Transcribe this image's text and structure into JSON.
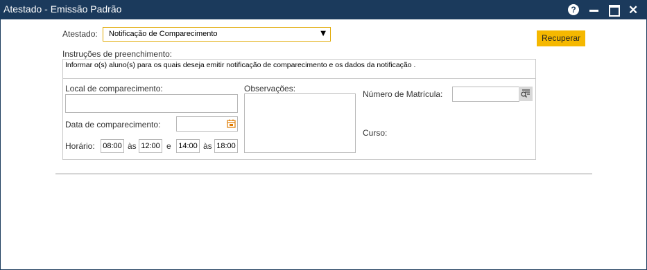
{
  "window": {
    "title": "Atestado - Emissão Padrão",
    "help_icon": "question-circle-icon",
    "help_glyph": "?",
    "close_glyph": "✕"
  },
  "form": {
    "atestado_label": "Atestado:",
    "atestado_value": "Notificação de Comparecimento",
    "recover_label": "Recuperar",
    "instructions_label": "Instruções de preenchimento:",
    "instructions_text": "Informar o(s) aluno(s) para os quais deseja emitir notificação de comparecimento e os dados da notificação .",
    "local_label": "Local de comparecimento:",
    "local_value": "",
    "data_label": "Data de comparecimento:",
    "data_value": "",
    "horario_label": "Horário:",
    "as_label": "às",
    "e_label": "e",
    "time1": "08:00",
    "time2": "12:00",
    "time3": "14:00",
    "time4": "18:00",
    "obs_label": "Observações:",
    "matricula_label": "Número de Matrícula:",
    "matricula_value": "",
    "curso_label": "Curso:"
  },
  "colors": {
    "titlebar": "#1b3a5c",
    "accent": "#f5b800",
    "calendar_icon": "#e07b00"
  }
}
